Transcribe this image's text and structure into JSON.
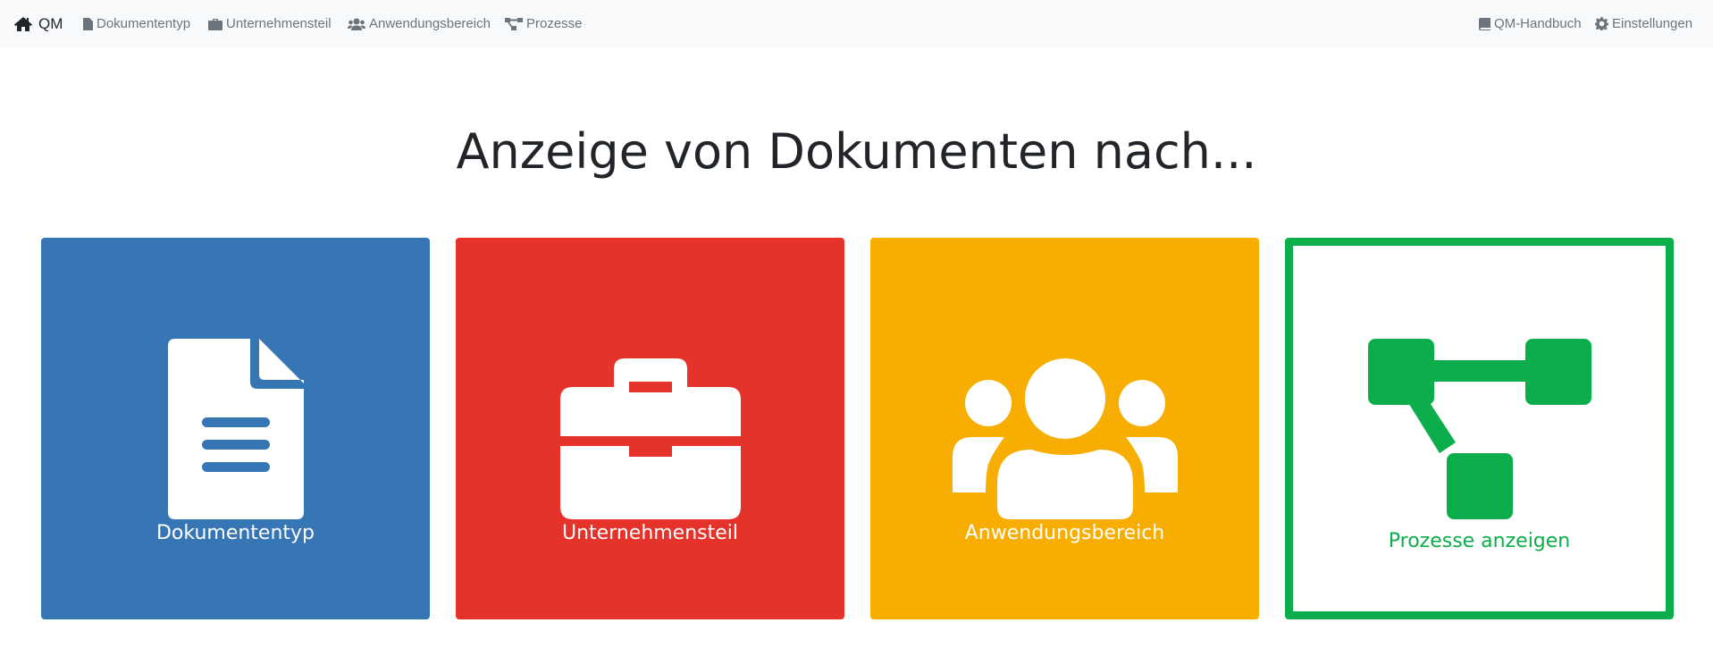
{
  "navbar": {
    "brand": {
      "label": "QM",
      "icon": "home-icon"
    },
    "left_items": [
      {
        "label": "Dokumententyp",
        "icon": "file-icon"
      },
      {
        "label": "Unternehmensteil",
        "icon": "briefcase-icon"
      },
      {
        "label": "Anwendungsbereich",
        "icon": "users-icon"
      },
      {
        "label": "Prozesse",
        "icon": "sitemap-icon"
      }
    ],
    "right_items": [
      {
        "label": "QM-Handbuch",
        "icon": "book-icon"
      },
      {
        "label": "Einstellungen",
        "icon": "gear-icon"
      }
    ]
  },
  "main": {
    "headline": "Anzeige von Dokumenten nach...",
    "cards": [
      {
        "label": "Dokumententyp",
        "icon": "file-icon",
        "color": "#3776b5"
      },
      {
        "label": "Unternehmensteil",
        "icon": "briefcase-icon",
        "color": "#e5322b"
      },
      {
        "label": "Anwendungsbereich",
        "icon": "users-icon",
        "color": "#f8ae00"
      },
      {
        "label": "Prozesse anzeigen",
        "icon": "sitemap-icon",
        "color": "#0bae4a"
      }
    ]
  }
}
